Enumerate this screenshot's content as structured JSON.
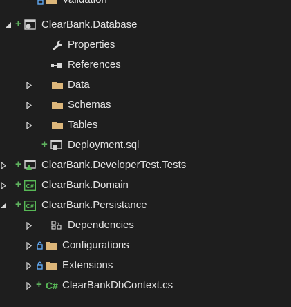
{
  "tree": {
    "items": [
      {
        "label": "Validation",
        "kind": "folder",
        "state": "collapsed",
        "added": true,
        "locked": true
      },
      {
        "label": "ClearBank.Database",
        "kind": "db-project",
        "state": "expanded",
        "added": true
      },
      {
        "label": "Properties",
        "kind": "properties"
      },
      {
        "label": "References",
        "kind": "references"
      },
      {
        "label": "Data",
        "kind": "folder",
        "state": "collapsed"
      },
      {
        "label": "Schemas",
        "kind": "folder",
        "state": "collapsed"
      },
      {
        "label": "Tables",
        "kind": "folder",
        "state": "collapsed"
      },
      {
        "label": "Deployment.sql",
        "kind": "sql-file",
        "added": true
      },
      {
        "label": "ClearBank.DeveloperTest.Tests",
        "kind": "test-project",
        "state": "collapsed",
        "added": true
      },
      {
        "label": "ClearBank.Domain",
        "kind": "cs-project",
        "state": "collapsed",
        "added": true
      },
      {
        "label": "ClearBank.Persistance",
        "kind": "cs-project",
        "state": "expanded",
        "added": true
      },
      {
        "label": "Dependencies",
        "kind": "dependencies",
        "state": "collapsed"
      },
      {
        "label": "Configurations",
        "kind": "folder",
        "state": "collapsed",
        "locked": true
      },
      {
        "label": "Extensions",
        "kind": "folder",
        "state": "collapsed",
        "locked": true
      },
      {
        "label": "ClearBankDbContext.cs",
        "kind": "cs-file",
        "state": "collapsed",
        "added": true
      }
    ],
    "file_icon_text": "C#"
  },
  "colors": {
    "background": "#1e1e1e",
    "text": "#e2e2e2",
    "added_plus": "#5fb35f",
    "folder": "#dcb67a",
    "lock": "#61a9f2",
    "cs_green": "#58b957"
  }
}
